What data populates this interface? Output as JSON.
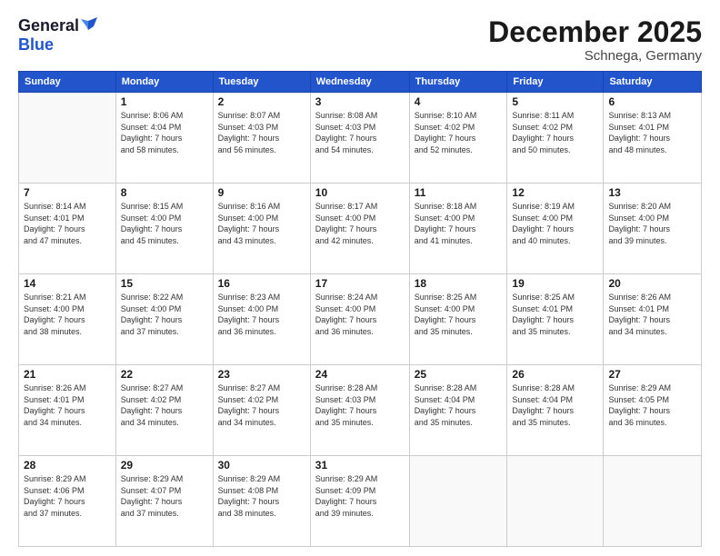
{
  "header": {
    "logo_line1": "General",
    "logo_line2": "Blue",
    "main_title": "December 2025",
    "subtitle": "Schnega, Germany"
  },
  "calendar": {
    "days_of_week": [
      "Sunday",
      "Monday",
      "Tuesday",
      "Wednesday",
      "Thursday",
      "Friday",
      "Saturday"
    ],
    "weeks": [
      [
        {
          "day": "",
          "info": ""
        },
        {
          "day": "1",
          "info": "Sunrise: 8:06 AM\nSunset: 4:04 PM\nDaylight: 7 hours\nand 58 minutes."
        },
        {
          "day": "2",
          "info": "Sunrise: 8:07 AM\nSunset: 4:03 PM\nDaylight: 7 hours\nand 56 minutes."
        },
        {
          "day": "3",
          "info": "Sunrise: 8:08 AM\nSunset: 4:03 PM\nDaylight: 7 hours\nand 54 minutes."
        },
        {
          "day": "4",
          "info": "Sunrise: 8:10 AM\nSunset: 4:02 PM\nDaylight: 7 hours\nand 52 minutes."
        },
        {
          "day": "5",
          "info": "Sunrise: 8:11 AM\nSunset: 4:02 PM\nDaylight: 7 hours\nand 50 minutes."
        },
        {
          "day": "6",
          "info": "Sunrise: 8:13 AM\nSunset: 4:01 PM\nDaylight: 7 hours\nand 48 minutes."
        }
      ],
      [
        {
          "day": "7",
          "info": "Sunrise: 8:14 AM\nSunset: 4:01 PM\nDaylight: 7 hours\nand 47 minutes."
        },
        {
          "day": "8",
          "info": "Sunrise: 8:15 AM\nSunset: 4:00 PM\nDaylight: 7 hours\nand 45 minutes."
        },
        {
          "day": "9",
          "info": "Sunrise: 8:16 AM\nSunset: 4:00 PM\nDaylight: 7 hours\nand 43 minutes."
        },
        {
          "day": "10",
          "info": "Sunrise: 8:17 AM\nSunset: 4:00 PM\nDaylight: 7 hours\nand 42 minutes."
        },
        {
          "day": "11",
          "info": "Sunrise: 8:18 AM\nSunset: 4:00 PM\nDaylight: 7 hours\nand 41 minutes."
        },
        {
          "day": "12",
          "info": "Sunrise: 8:19 AM\nSunset: 4:00 PM\nDaylight: 7 hours\nand 40 minutes."
        },
        {
          "day": "13",
          "info": "Sunrise: 8:20 AM\nSunset: 4:00 PM\nDaylight: 7 hours\nand 39 minutes."
        }
      ],
      [
        {
          "day": "14",
          "info": "Sunrise: 8:21 AM\nSunset: 4:00 PM\nDaylight: 7 hours\nand 38 minutes."
        },
        {
          "day": "15",
          "info": "Sunrise: 8:22 AM\nSunset: 4:00 PM\nDaylight: 7 hours\nand 37 minutes."
        },
        {
          "day": "16",
          "info": "Sunrise: 8:23 AM\nSunset: 4:00 PM\nDaylight: 7 hours\nand 36 minutes."
        },
        {
          "day": "17",
          "info": "Sunrise: 8:24 AM\nSunset: 4:00 PM\nDaylight: 7 hours\nand 36 minutes."
        },
        {
          "day": "18",
          "info": "Sunrise: 8:25 AM\nSunset: 4:00 PM\nDaylight: 7 hours\nand 35 minutes."
        },
        {
          "day": "19",
          "info": "Sunrise: 8:25 AM\nSunset: 4:01 PM\nDaylight: 7 hours\nand 35 minutes."
        },
        {
          "day": "20",
          "info": "Sunrise: 8:26 AM\nSunset: 4:01 PM\nDaylight: 7 hours\nand 34 minutes."
        }
      ],
      [
        {
          "day": "21",
          "info": "Sunrise: 8:26 AM\nSunset: 4:01 PM\nDaylight: 7 hours\nand 34 minutes."
        },
        {
          "day": "22",
          "info": "Sunrise: 8:27 AM\nSunset: 4:02 PM\nDaylight: 7 hours\nand 34 minutes."
        },
        {
          "day": "23",
          "info": "Sunrise: 8:27 AM\nSunset: 4:02 PM\nDaylight: 7 hours\nand 34 minutes."
        },
        {
          "day": "24",
          "info": "Sunrise: 8:28 AM\nSunset: 4:03 PM\nDaylight: 7 hours\nand 35 minutes."
        },
        {
          "day": "25",
          "info": "Sunrise: 8:28 AM\nSunset: 4:04 PM\nDaylight: 7 hours\nand 35 minutes."
        },
        {
          "day": "26",
          "info": "Sunrise: 8:28 AM\nSunset: 4:04 PM\nDaylight: 7 hours\nand 35 minutes."
        },
        {
          "day": "27",
          "info": "Sunrise: 8:29 AM\nSunset: 4:05 PM\nDaylight: 7 hours\nand 36 minutes."
        }
      ],
      [
        {
          "day": "28",
          "info": "Sunrise: 8:29 AM\nSunset: 4:06 PM\nDaylight: 7 hours\nand 37 minutes."
        },
        {
          "day": "29",
          "info": "Sunrise: 8:29 AM\nSunset: 4:07 PM\nDaylight: 7 hours\nand 37 minutes."
        },
        {
          "day": "30",
          "info": "Sunrise: 8:29 AM\nSunset: 4:08 PM\nDaylight: 7 hours\nand 38 minutes."
        },
        {
          "day": "31",
          "info": "Sunrise: 8:29 AM\nSunset: 4:09 PM\nDaylight: 7 hours\nand 39 minutes."
        },
        {
          "day": "",
          "info": ""
        },
        {
          "day": "",
          "info": ""
        },
        {
          "day": "",
          "info": ""
        }
      ]
    ]
  }
}
